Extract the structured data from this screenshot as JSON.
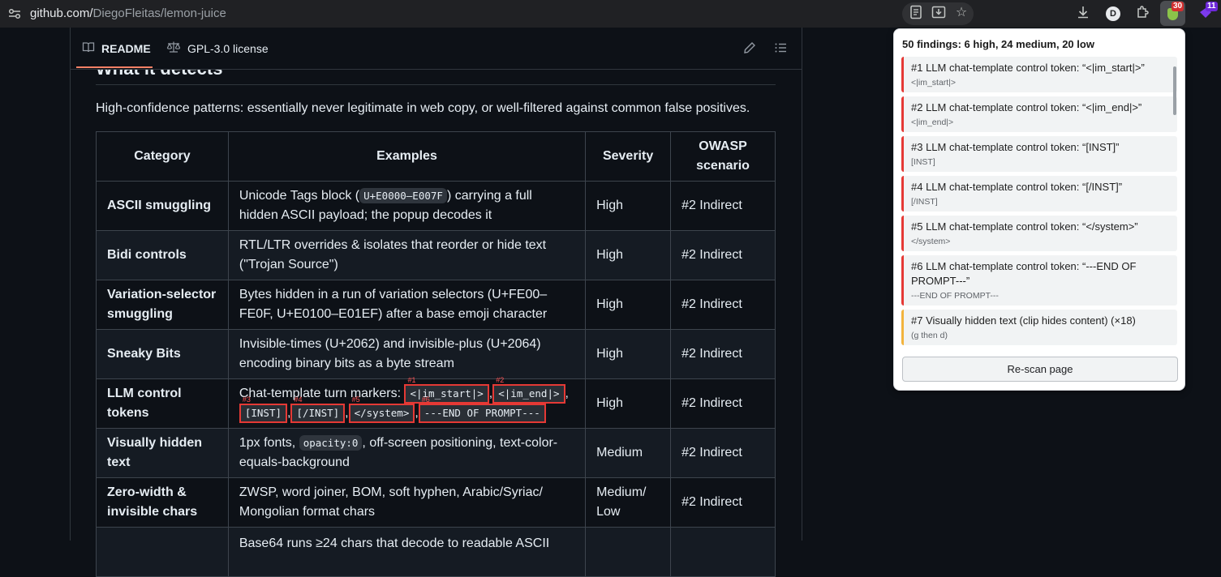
{
  "browser": {
    "url_host": "github.com/",
    "url_path": "DiegoFleitas/lemon-juice",
    "profile_initial": "D",
    "ext_badge_count": "30",
    "ext2_badge_count": "11"
  },
  "readme": {
    "tabs": [
      {
        "label": "README"
      },
      {
        "label": "GPL-3.0 license"
      }
    ],
    "section_heading": "What it detects",
    "intro": "High-confidence patterns: essentially never legitimate in web copy, or well-filtered against common false positives.",
    "table": {
      "headers": [
        "Category",
        "Examples",
        "Severity",
        "OWASP scenario"
      ],
      "rows": [
        {
          "category": "ASCII smuggling",
          "ex_a": "Unicode Tags block (",
          "ex_code": "U+E0000–E007F",
          "ex_b": ") carrying a full hidden ASCII payload; the popup decodes it",
          "severity": "High",
          "owasp": "#2 Indirect"
        },
        {
          "category": "Bidi controls",
          "ex": "RTL/LTR overrides & isolates that reorder or hide text (\"Trojan Source\")",
          "severity": "High",
          "owasp": "#2 Indirect"
        },
        {
          "category": "Variation-selector smuggling",
          "ex": "Bytes hidden in a run of variation selectors (U+FE00–FE0F, U+E0100–E01EF) after a base emoji character",
          "severity": "High",
          "owasp": "#2 Indirect"
        },
        {
          "category": "Sneaky Bits",
          "ex": "Invisible-times (U+2062) and invisible-plus (U+2064) encoding binary bits as a byte stream",
          "severity": "High",
          "owasp": "#2 Indirect"
        },
        {
          "category": "LLM control tokens",
          "ex_prefix": "Chat-template turn markers: ",
          "tokens": [
            {
              "num": "#1",
              "text": "<|im_start|>"
            },
            {
              "num": "#2",
              "text": "<|im_end|>"
            },
            {
              "num": "#3",
              "text": "[INST]"
            },
            {
              "num": "#4",
              "text": "[/INST]"
            },
            {
              "num": "#5",
              "text": "</system>"
            },
            {
              "num": "#6",
              "text": "---END OF PROMPT---"
            }
          ],
          "sep": ",",
          "severity": "High",
          "owasp": "#2 Indirect"
        },
        {
          "category": "Visually hidden text",
          "ex_a": "1px fonts, ",
          "ex_code": "opacity:0",
          "ex_b": ", off-screen positioning, text-color-equals-background",
          "severity": "Medium",
          "owasp": "#2 Indirect"
        },
        {
          "category": "Zero-width & invisible chars",
          "ex": "ZWSP, word joiner, BOM, soft hyphen, Arabic/Syriac/ Mongolian format chars",
          "severity": "Medium/ Low",
          "owasp": "#2 Indirect"
        },
        {
          "category": "",
          "ex": "Base64 runs ≥24 chars that decode to readable ASCII",
          "severity": "",
          "owasp": ""
        }
      ]
    }
  },
  "popup": {
    "summary": "50 findings: 6 high, 24 medium, 20 low",
    "findings": [
      {
        "title": "#1 LLM chat-template control token: “<|im_start|>”",
        "snippet": "<|im_start|>",
        "severity": "high"
      },
      {
        "title": "#2 LLM chat-template control token: “<|im_end|>”",
        "snippet": "<|im_end|>",
        "severity": "high"
      },
      {
        "title": "#3 LLM chat-template control token: “[INST]”",
        "snippet": "[INST]",
        "severity": "high"
      },
      {
        "title": "#4 LLM chat-template control token: “[/INST]”",
        "snippet": "[/INST]",
        "severity": "high"
      },
      {
        "title": "#5 LLM chat-template control token: “</system>”",
        "snippet": "</system>",
        "severity": "high"
      },
      {
        "title": "#6 LLM chat-template control token: “---END OF PROMPT---”",
        "snippet": "---END OF PROMPT---",
        "severity": "high"
      },
      {
        "title": "#7 Visually hidden text (clip hides content) (×18)",
        "snippet": "(g then d)",
        "severity": "medium"
      }
    ],
    "rescan_label": "Re-scan page"
  },
  "colors": {
    "high": "#e53935",
    "medium": "#f2b33d",
    "accent_tab": "#f78166"
  }
}
